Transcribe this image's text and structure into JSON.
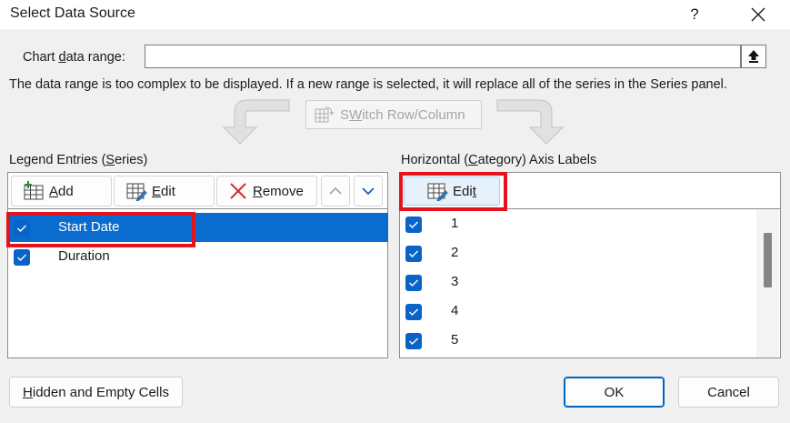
{
  "window": {
    "title": "Select Data Source",
    "help_label": "?"
  },
  "chart_range": {
    "label_pre": "Chart ",
    "label_key": "d",
    "label_post": "ata range:",
    "value": "",
    "info": "The data range is too complex to be displayed. If a new range is selected, it will replace all of the series in the Series panel."
  },
  "switch_button": {
    "label_key": "W",
    "label_pre": "S",
    "label_post": "itch Row/Column"
  },
  "legend": {
    "title_pre": "Legend Entries (",
    "title_key": "S",
    "title_post": "eries)",
    "add": {
      "key": "A",
      "rest": "dd"
    },
    "edit": {
      "key": "E",
      "rest": "dit"
    },
    "remove": {
      "key": "R",
      "rest": "emove"
    },
    "series": [
      {
        "name": "Start Date",
        "checked": true,
        "selected": true
      },
      {
        "name": "Duration",
        "checked": true,
        "selected": false
      }
    ]
  },
  "axis": {
    "title_pre": "Horizontal (",
    "title_key": "C",
    "title_post": "ategory) Axis Labels",
    "edit": {
      "pre": "Edi",
      "key": "t"
    },
    "labels": [
      "1",
      "2",
      "3",
      "4",
      "5"
    ]
  },
  "footer": {
    "hidden_key": "H",
    "hidden_rest": "idden and Empty Cells",
    "ok": "OK",
    "cancel": "Cancel"
  },
  "colors": {
    "accent": "#0a6ccf",
    "highlight": "#e3141e",
    "checkbox": "#0a64c8"
  }
}
